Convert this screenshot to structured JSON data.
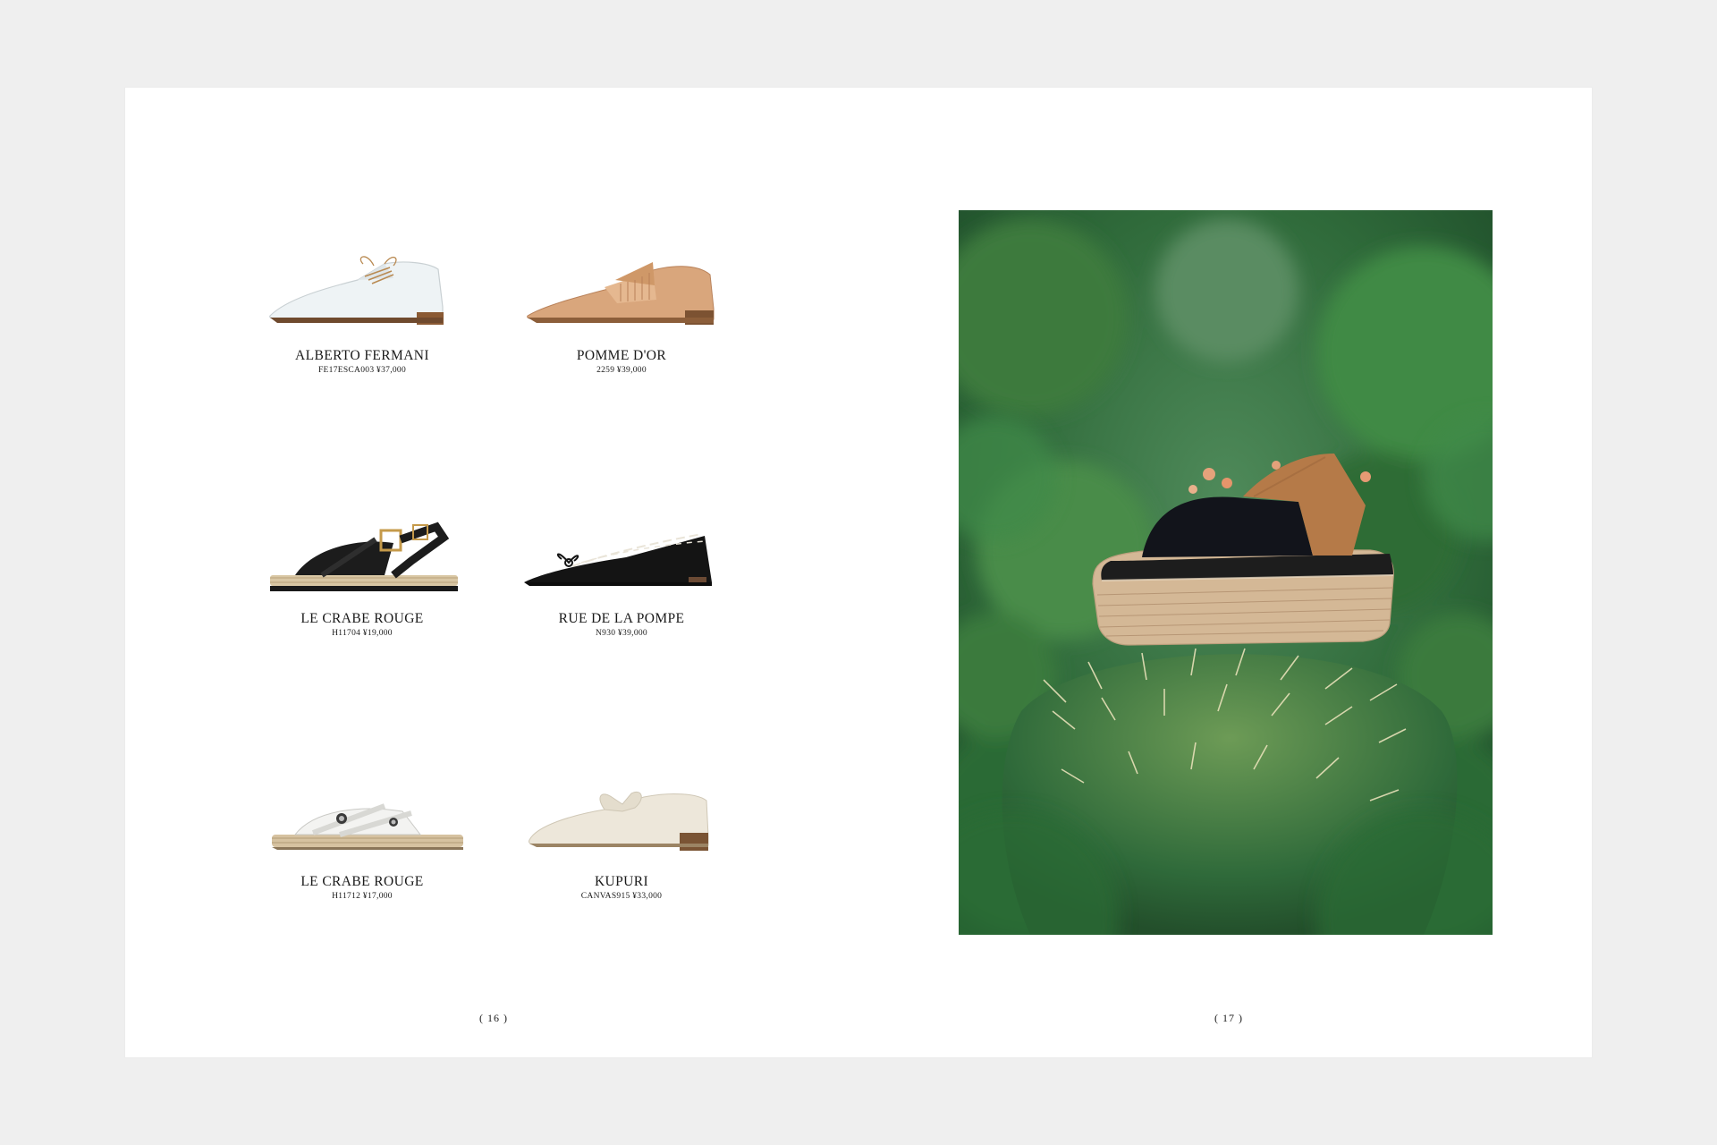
{
  "left_page": {
    "products": [
      {
        "brand": "ALBERTO FERMANI",
        "meta": "FE17ESCA003 ¥37,000",
        "shoe_icon": "oxford-shoe-white-icon",
        "color": "#e9eef0"
      },
      {
        "brand": "POMME D'OR",
        "meta": "2259 ¥39,000",
        "shoe_icon": "kiltie-loafer-tan-icon",
        "color": "#d9a67c"
      },
      {
        "brand": "LE CRABE ROUGE",
        "meta": "H11704 ¥19,000",
        "shoe_icon": "espadrille-sandal-black-icon",
        "color": "#1c1c1c"
      },
      {
        "brand": "RUE DE LA POMPE",
        "meta": "N930 ¥39,000",
        "shoe_icon": "ballet-flat-black-icon",
        "color": "#141414"
      },
      {
        "brand": "LE CRABE ROUGE",
        "meta": "H11712 ¥17,000",
        "shoe_icon": "espadrille-slide-white-icon",
        "color": "#f1f1ef"
      },
      {
        "brand": "KUPURI",
        "meta": "CANVAS915 ¥33,000",
        "shoe_icon": "bow-shoe-cream-icon",
        "color": "#ede7da"
      }
    ],
    "folio": "( 16 )"
  },
  "right_page": {
    "photo_icon": "cork-platform-mule-on-cactus-photo",
    "folio": "( 17 )"
  }
}
